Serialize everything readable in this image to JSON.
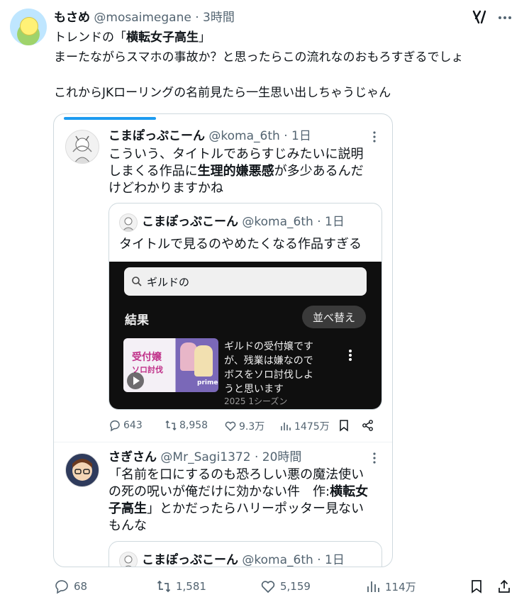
{
  "post": {
    "display_name": "もさめ",
    "handle": "@mosaimegane",
    "dot": "·",
    "time": "3時間",
    "line1_prefix": "トレンドの「",
    "line1_bold": "横転女子高生",
    "line1_suffix": "」",
    "line2": "まーたながらスマホの事故か？と思ったらこの流れなのおもろすぎるでしょ",
    "line3": "これからJKローリングの名前見たら一生思い出しちゃうじゃん",
    "stats": {
      "replies": "68",
      "reposts": "1,581",
      "likes": "5,159",
      "views": "114万"
    }
  },
  "embedded_post": {
    "display_name": "こまぽっぷこーん",
    "handle": "@koma_6th",
    "dot": "·",
    "time": "1日",
    "body_line1": "こういう、タイトルであらすじみたいに説明",
    "body_line2_a": "しまくる作品に",
    "body_line2_bold": "生理的嫌悪感",
    "body_line2_b": "が多少あるんだ",
    "body_line3": "けどわかりますかね",
    "stats": {
      "replies": "643",
      "reposts": "8,958",
      "likes": "9.3万",
      "views": "1475万"
    }
  },
  "quoted_post": {
    "display_name": "こまぽっぷこーん",
    "handle": "@koma_6th",
    "dot": "·",
    "time": "1日",
    "body": "タイトルで見るのやめたくなる作品すぎる",
    "screenshot": {
      "search_value": "ギルドの",
      "results_label": "結果",
      "sort_button": "並べ替え",
      "result_title_1": "ギルドの受付嬢です",
      "result_title_2": "が、残業は嫌なので",
      "result_title_3": "ボスをソロ討伐しよ",
      "result_title_4": "うと思います",
      "result_meta": "2025 1シーズン",
      "thumb_text_1": "受付嬢",
      "thumb_text_2": "ソロ討伐",
      "thumb_brand": "prime"
    }
  },
  "reply_post": {
    "display_name": "さぎさん",
    "handle": "@Mr_Sagi1372",
    "dot": "·",
    "time": "20時間",
    "body_line1": "「名前を口にするのも恐ろしい悪の魔法使い",
    "body_line2_a": "の死の呪いが俺だけに効かない件　作:",
    "body_line2_bold": "横転女",
    "body_line3_bold": "子高生",
    "body_line3_b": "」とかだったらハリーポッター見ない",
    "body_line4": "もんな"
  },
  "quoted_post_2": {
    "display_name": "こまぽっぷこーん",
    "handle": "@koma_6th",
    "dot": "·",
    "time": "1日"
  },
  "colors": {
    "accent": "#1d9bf0",
    "text": "#0f1419",
    "muted": "#536471"
  }
}
